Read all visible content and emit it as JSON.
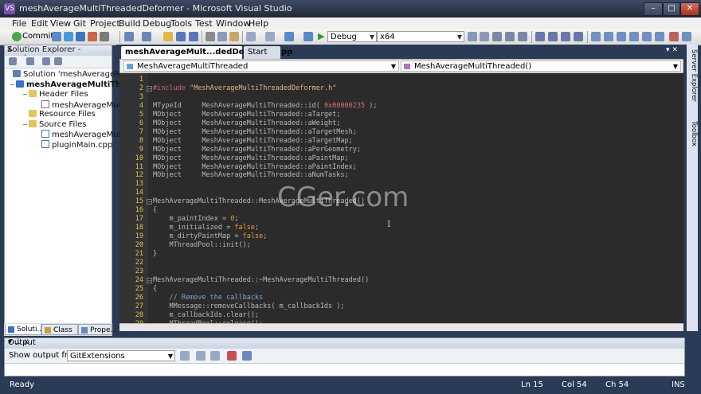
{
  "window": {
    "title": "meshAverageMultiThreadedDeformer - Microsoft Visual Studio",
    "app_icon": "VS",
    "min": "–",
    "max": "□",
    "close": "✕"
  },
  "menu": [
    "File",
    "Edit",
    "View",
    "Git",
    "Project",
    "Build",
    "Debug",
    "Tools",
    "Test",
    "Window",
    "Help"
  ],
  "toolbar": {
    "commit_label": "Commit",
    "config": "Debug",
    "platform": "x64"
  },
  "solution_explorer": {
    "title": "Solution Explorer - mesh...",
    "pin": "⊥",
    "close": "x",
    "items": [
      {
        "label": "Solution 'meshAverageMultiThreadedDeformer'",
        "kind": "sln",
        "indent": 0,
        "expander": ""
      },
      {
        "label": "meshAverageMultiThreadedDeformer",
        "kind": "proj",
        "indent": 1,
        "expander": "−",
        "bold": true
      },
      {
        "label": "Header Files",
        "kind": "folder",
        "indent": 2,
        "expander": "−"
      },
      {
        "label": "meshAverageMultiThreadedDeformer.h",
        "kind": "h",
        "indent": 3,
        "expander": ""
      },
      {
        "label": "Resource Files",
        "kind": "folder",
        "indent": 2,
        "expander": ""
      },
      {
        "label": "Source Files",
        "kind": "folder",
        "indent": 2,
        "expander": "−"
      },
      {
        "label": "meshAverageMultiThreadedDeformer.cpp",
        "kind": "cpp",
        "indent": 3,
        "expander": ""
      },
      {
        "label": "pluginMain.cpp",
        "kind": "cpp",
        "indent": 3,
        "expander": ""
      }
    ],
    "tabs": [
      "Soluti...",
      "Class ...",
      "Prope..."
    ]
  },
  "editor": {
    "tabs": [
      {
        "label": "meshAverageMult...dedDeformer.cpp",
        "active": true
      },
      {
        "label": "Start Page",
        "active": false
      }
    ],
    "tab_controls": "▾ ✕",
    "nav_left": "MeshAverageMultiThreaded",
    "nav_right": "MeshAverageMultiThreaded()",
    "lines": [
      {
        "n": "1",
        "html": ""
      },
      {
        "n": "2",
        "html": "<span class='pp'>#include</span> <span class='str'>\"MeshAverageMultiThreadedDeformer.h\"</span>",
        "fold": "−"
      },
      {
        "n": "3",
        "html": ""
      },
      {
        "n": "4",
        "html": "<span class='dim'>MTypeId     MeshAverageMultiThreaded::id( </span><span class='hex'>0x00000235</span><span class='dim'> );</span>"
      },
      {
        "n": "5",
        "html": "<span class='dim'>MObject     MeshAverageMultiThreaded::aTarget;</span>"
      },
      {
        "n": "6",
        "html": "<span class='dim'>MObject     MeshAverageMultiThreaded::aWeight;</span>"
      },
      {
        "n": "7",
        "html": "<span class='dim'>MObject     MeshAverageMultiThreaded::aTargetMesh;</span>"
      },
      {
        "n": "8",
        "html": "<span class='dim'>MObject     MeshAverageMultiThreaded::aTargetMap;</span>"
      },
      {
        "n": "9",
        "html": "<span class='dim'>MObject     MeshAverageMultiThreaded::aPerGeometry;</span>"
      },
      {
        "n": "10",
        "html": "<span class='dim'>MObject     MeshAverageMultiThreaded::aPaintMap;</span>"
      },
      {
        "n": "11",
        "html": "<span class='dim'>MObject     MeshAverageMultiThreaded::aPaintIndex;</span>"
      },
      {
        "n": "12",
        "html": "<span class='dim'>MObject     MeshAverageMultiThreaded::aNumTasks;</span>"
      },
      {
        "n": "13",
        "html": ""
      },
      {
        "n": "14",
        "html": ""
      },
      {
        "n": "15",
        "html": "<span class='dim'>MeshAverageMultiThreaded::MeshAverageMultiThreaded()</span>",
        "fold": "−"
      },
      {
        "n": "16",
        "html": "<span class='dim'>{</span>"
      },
      {
        "n": "17",
        "html": "<span class='dim'>    m_paintIndex = </span><span class='kw'>0</span><span class='dim'>;</span>"
      },
      {
        "n": "18",
        "html": "<span class='dim'>    m_initialized = </span><span class='kw'>false</span><span class='dim'>;</span>"
      },
      {
        "n": "19",
        "html": "<span class='dim'>    m_dirtyPaintMap = </span><span class='kw'>false</span><span class='dim'>;</span>"
      },
      {
        "n": "20",
        "html": "<span class='dim'>    MThreadPool::init();</span>"
      },
      {
        "n": "21",
        "html": "<span class='dim'>}</span>"
      },
      {
        "n": "22",
        "html": ""
      },
      {
        "n": "23",
        "html": ""
      },
      {
        "n": "24",
        "html": "<span class='dim'>MeshAverageMultiThreaded::~MeshAverageMultiThreaded()</span>",
        "fold": "−"
      },
      {
        "n": "25",
        "html": "<span class='dim'>{</span>"
      },
      {
        "n": "26",
        "html": "<span class='cm'>    // Remove the callbacks</span>"
      },
      {
        "n": "27",
        "html": "<span class='dim'>    MMessage::removeCallbacks( m_callbackIds );</span>"
      },
      {
        "n": "28",
        "html": "<span class='dim'>    m_callbackIds.clear();</span>"
      },
      {
        "n": "29",
        "html": "<span class='dim'>    MThreadPool::release();</span>"
      }
    ]
  },
  "side_tabs": [
    "Server Explorer",
    "Toolbox"
  ],
  "watermark": "CGer.com",
  "output": {
    "title": "Output",
    "controls": "▾ ⊥ x",
    "show_from_label": "Show output from:",
    "source": "GitExtensions"
  },
  "status": {
    "ready": "Ready",
    "ln": "Ln 15",
    "col": "Col 54",
    "ch": "Ch 54",
    "ins": "INS"
  },
  "colors": {
    "accent": "#2b3b55",
    "editor_bg": "#2b2b2b",
    "line_number": "#d8c84a"
  }
}
